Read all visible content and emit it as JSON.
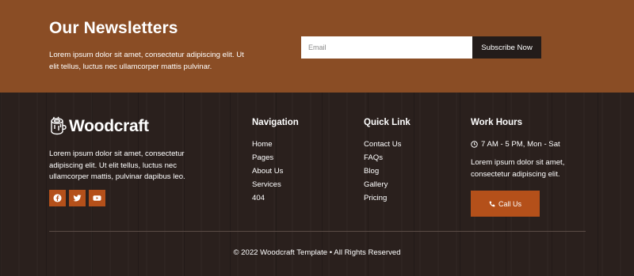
{
  "newsletter": {
    "title": "Our Newsletters",
    "text": "Lorem ipsum dolor sit amet, consectetur adipiscing elit. Ut elit tellus, luctus nec ullamcorper mattis pulvinar.",
    "email_placeholder": "Email",
    "email_value": "",
    "subscribe_label": "Subscribe Now"
  },
  "brand": {
    "logo_icon": "log-stump-icon",
    "name": "Woodcraft",
    "description": "Lorem ipsum dolor sit amet, consectetur adipiscing elit. Ut elit tellus, luctus nec ullamcorper mattis, pulvinar dapibus leo.",
    "socials": [
      {
        "icon": "facebook-icon"
      },
      {
        "icon": "twitter-icon"
      },
      {
        "icon": "youtube-icon"
      }
    ]
  },
  "navigation": {
    "title": "Navigation",
    "items": [
      "Home",
      "Pages",
      "About Us",
      "Services",
      "404"
    ]
  },
  "quick_link": {
    "title": "Quick Link",
    "items": [
      "Contact Us",
      "FAQs",
      "Blog",
      "Gallery",
      "Pricing"
    ]
  },
  "work_hours": {
    "title": "Work Hours",
    "hours_icon": "clock-icon",
    "hours": "7 AM - 5 PM, Mon - Sat",
    "description": "Lorem ipsum dolor sit amet, consectetur adipiscing elit.",
    "call_icon": "phone-icon",
    "call_label": "Call Us"
  },
  "footer": {
    "copyright": "© 2022 Woodcraft Template • All Rights Reserved"
  },
  "colors": {
    "newsletter_bg": "#8a4d25",
    "footer_bg": "#2a201d",
    "accent": "#b4501a",
    "button_dark": "#231c1a"
  }
}
